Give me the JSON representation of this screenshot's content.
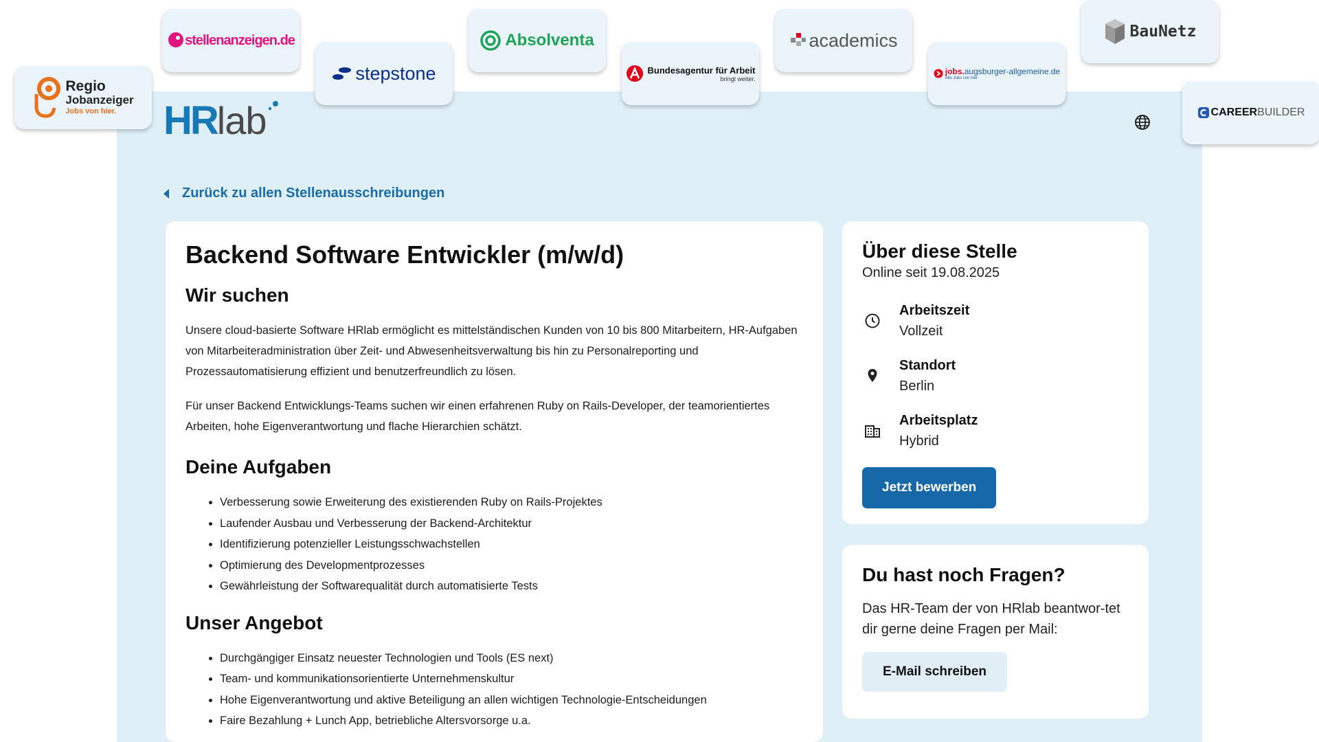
{
  "partners": {
    "regio_line1": "Regio",
    "regio_line2": "Jobanzeiger",
    "regio_tagline": "Jobs von hier.",
    "stellenanzeigen": "stellenanzeigen.de",
    "stepstone": "stepstone",
    "absolventa": "Absolventa",
    "bundesagentur": "Bundesagentur für Arbeit",
    "bundesagentur_tagline": "bringt weiter.",
    "academics": "academics",
    "augsburger_prefix": "jobs.",
    "augsburger_domain": "augsburger-allgemeine.de",
    "augsburger_tagline": "Alle Jobs von hier",
    "baunetz": "BauNetz",
    "careerbuilder_bold": "CAREER",
    "careerbuilder_thin": "BUILDER"
  },
  "header": {
    "brand_hr": "HR",
    "brand_lab": "lab",
    "back_link": "Zurück zu allen Stellenausschreibungen"
  },
  "job": {
    "title": "Backend Software Entwickler (m/w/d)",
    "sections": {
      "wir_suchen": {
        "heading": "Wir suchen",
        "paragraphs": [
          "Unsere cloud-basierte Software HRlab ermöglicht es mittelständischen Kunden von 10 bis 800 Mitarbeitern, HR-Aufgaben von Mitarbeiteradministration über Zeit- und Abwesenheitsverwaltung bis hin zu Personalreporting und Prozessautomatisierung effizient und benutzerfreundlich zu lösen.",
          "Für unser Backend Entwicklungs-Teams suchen wir einen erfahrenen Ruby on Rails-Developer, der teamorientiertes Arbeiten, hohe Eigenverantwortung und flache Hierarchien schätzt."
        ]
      },
      "aufgaben": {
        "heading": "Deine Aufgaben",
        "items": [
          "Verbesserung sowie Erweiterung des existierenden Ruby on Rails-Projektes",
          "Laufender Ausbau und Verbesserung der Backend-Architektur",
          "Identifizierung potenzieller Leistungsschwachstellen",
          "Optimierung des Developmentprozesses",
          "Gewährleistung der Softwarequalität durch automatisierte Tests"
        ]
      },
      "angebot": {
        "heading": "Unser Angebot",
        "items": [
          "Durchgängiger Einsatz neuester Technologien und Tools (ES next)",
          "Team- und kommunikationsorientierte Unternehmenskultur",
          "Hohe Eigenverantwortung und aktive Beteiligung an allen wichtigen Technologie-Entscheidungen",
          "Faire Bezahlung + Lunch App, betriebliche Altersvorsorge u.a."
        ]
      }
    }
  },
  "sidebar": {
    "title": "Über diese Stelle",
    "online_since": "Online seit 19.08.2025",
    "details": [
      {
        "label": "Arbeitszeit",
        "value": "Vollzeit",
        "icon": "clock-icon"
      },
      {
        "label": "Standort",
        "value": "Berlin",
        "icon": "location-pin-icon"
      },
      {
        "label": "Arbeitsplatz",
        "value": "Hybrid",
        "icon": "building-icon"
      }
    ],
    "apply_label": "Jetzt bewerben"
  },
  "faq": {
    "title": "Du hast noch Fragen?",
    "text": "Das HR-Team der von HRlab beantwor-tet dir gerne deine Fragen per Mail:",
    "email_label": "E-Mail schreiben"
  },
  "colors": {
    "page_bg": "#dfeff8",
    "primary": "#1768a8",
    "link": "#1a6ba8",
    "secondary_button": "#e2eef6"
  }
}
